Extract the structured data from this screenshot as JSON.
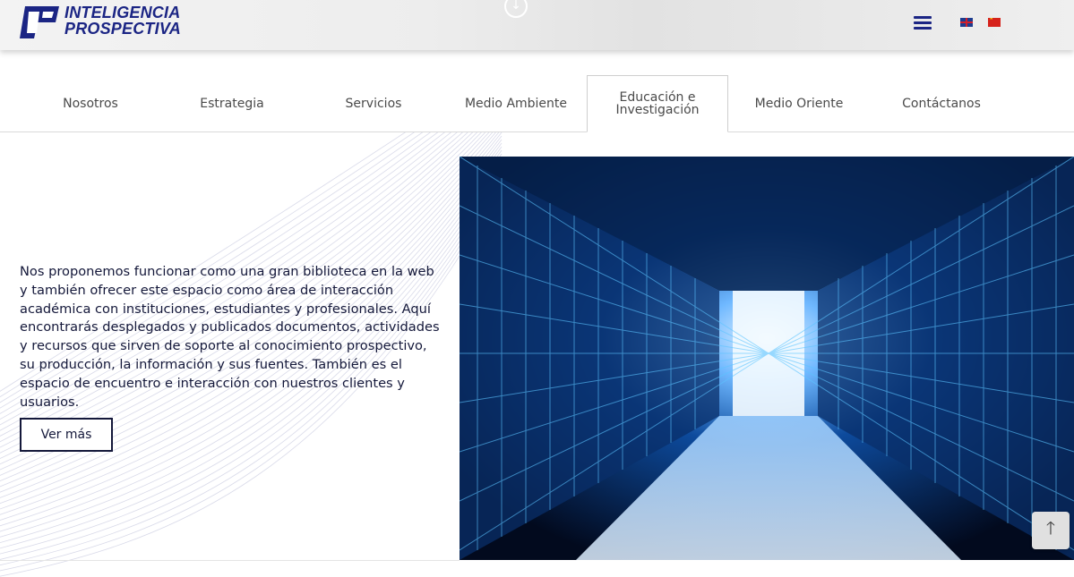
{
  "header": {
    "logo_line1": "INTELIGENCIA",
    "logo_line2": "PROSPECTIVA",
    "scroll_icon": "arrow-down-circle-icon",
    "menu_icon": "hamburger-menu-icon",
    "languages": [
      "english-flag-icon",
      "chinese-flag-icon"
    ],
    "brand_color": "#1b2584"
  },
  "tabs": [
    {
      "label": "Nosotros"
    },
    {
      "label": "Estrategia"
    },
    {
      "label": "Servicios"
    },
    {
      "label": "Medio Ambiente"
    },
    {
      "label": "Educación e\nInvestigación",
      "active": true
    },
    {
      "label": "Medio Oriente"
    },
    {
      "label": "Contáctanos"
    }
  ],
  "main": {
    "paragraph": "Nos proponemos funcionar como una gran biblioteca en la web y también ofrecer este espacio como área de interacción académica con instituciones, estudiantes y profesionales. Aquí encontrarás desplegados y publicados documentos, actividades y recursos que sirven de soporte al conocimiento prospectivo, su producción, la información y sus fuentes. También es el espacio de encuentro e interacción con nuestros clientes y usuarios.",
    "button_label": "Ver más",
    "hero_image": "data-center-server-corridor"
  },
  "back_to_top": "arrow-up-icon"
}
